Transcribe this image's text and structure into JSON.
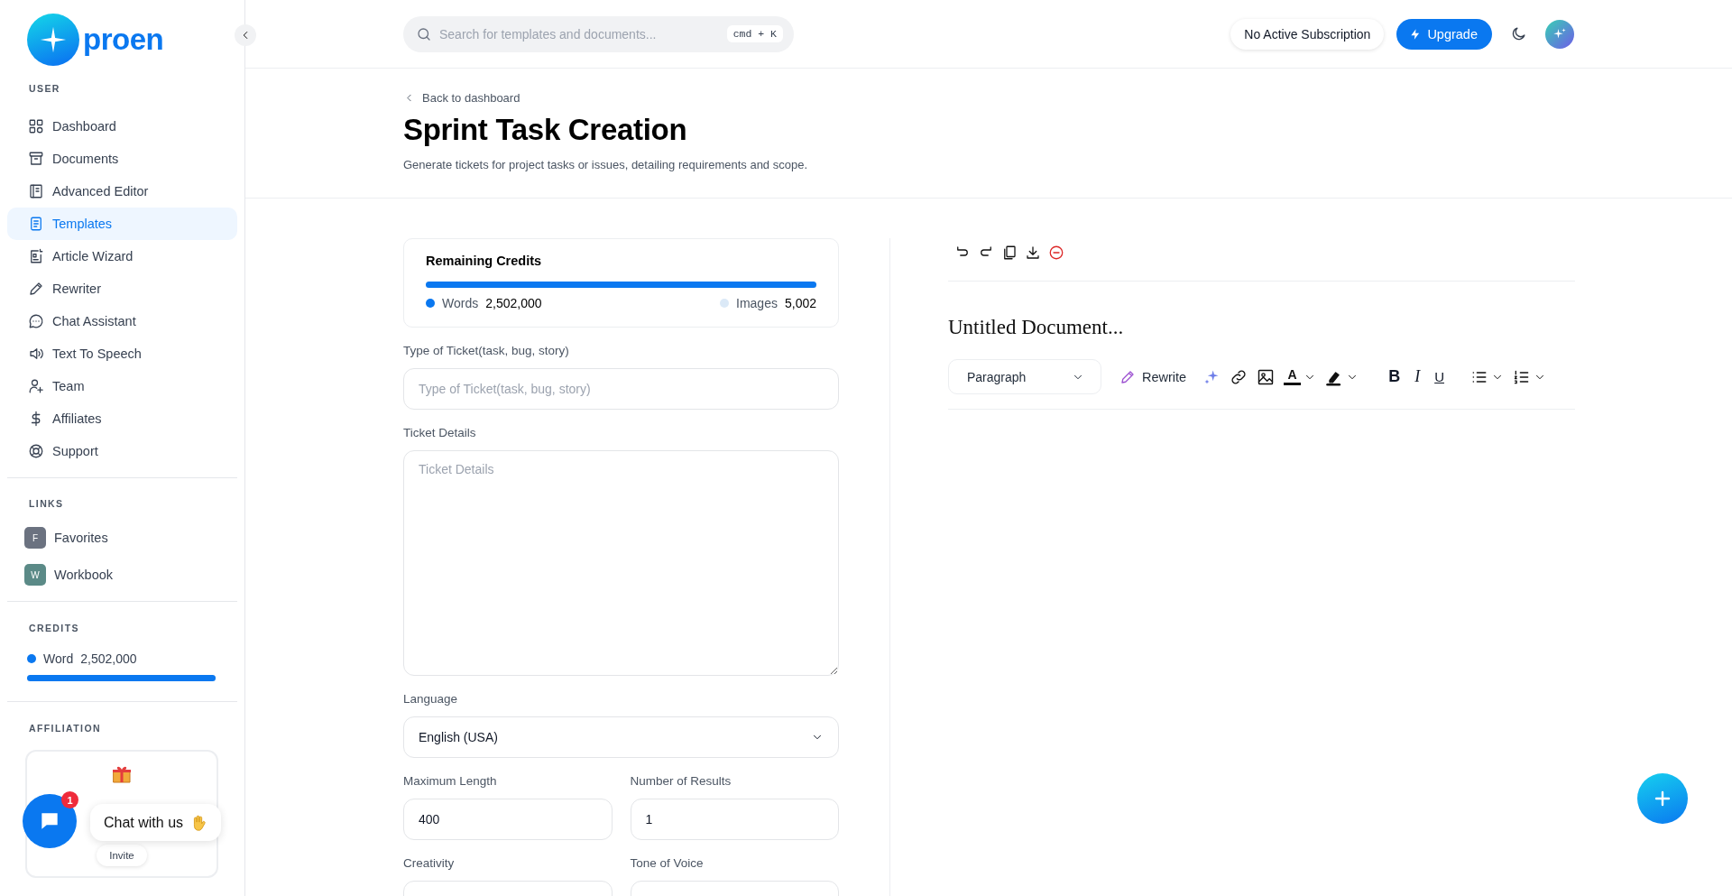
{
  "sidebar": {
    "brand": "proen",
    "nav": {
      "title": "USER",
      "items": [
        {
          "label": "Dashboard",
          "selected": false
        },
        {
          "label": "Documents",
          "selected": false
        },
        {
          "label": "Advanced Editor",
          "selected": false
        },
        {
          "label": "Templates",
          "selected": true
        },
        {
          "label": "Article Wizard",
          "selected": false
        },
        {
          "label": "Rewriter",
          "selected": false
        },
        {
          "label": "Chat Assistant",
          "selected": false
        },
        {
          "label": "Text To Speech",
          "selected": false
        },
        {
          "label": "Team",
          "selected": false
        },
        {
          "label": "Affiliates",
          "selected": false
        },
        {
          "label": "Support",
          "selected": false
        }
      ]
    },
    "links": {
      "title": "LINKS",
      "items": [
        {
          "letter": "F",
          "label": "Favorites",
          "color": "#6b7280"
        },
        {
          "letter": "W",
          "label": "Workbook",
          "color": "#5b8a87"
        }
      ]
    },
    "credits": {
      "title": "CREDITS",
      "label": "Word",
      "value": "2,502,000",
      "level": 1
    },
    "affiliation": {
      "title": "AFFILIATION",
      "button": "Invite"
    }
  },
  "chat": {
    "label": "Chat with us",
    "badge": "1"
  },
  "header": {
    "search_placeholder": "Search for templates and documents...",
    "shortcut": "cmd + K",
    "subscription": "No Active Subscription",
    "upgrade": "Upgrade",
    "dark_mode": false
  },
  "page": {
    "back": "Back to dashboard",
    "title": "Sprint Task Creation",
    "subtitle": "Generate tickets for project tasks or issues, detailing requirements and scope."
  },
  "credits_card": {
    "title": "Remaining Credits",
    "level": 1,
    "legend": [
      {
        "label": "Words",
        "value": "2,502,000",
        "color": "#0a78f0"
      },
      {
        "label": "Images",
        "value": "5,002",
        "color": "#dbe9f7"
      }
    ]
  },
  "form": {
    "rows": [
      {
        "fields": [
          {
            "kind": "text",
            "label": "Type of Ticket(task, bug, story)",
            "placeholder": "Type of Ticket(task, bug, story)"
          }
        ]
      },
      {
        "fields": [
          {
            "kind": "textarea",
            "label": "Ticket Details",
            "placeholder": "Ticket Details"
          }
        ]
      },
      {
        "fields": [
          {
            "kind": "select",
            "label": "Language",
            "value": "English (USA)"
          }
        ]
      },
      {
        "fields": [
          {
            "kind": "text",
            "label": "Maximum Length",
            "value": "400"
          },
          {
            "kind": "text",
            "label": "Number of Results",
            "value": "1"
          }
        ]
      },
      {
        "fields": [
          {
            "kind": "cut",
            "label": "Creativity"
          },
          {
            "kind": "cut",
            "label": "Tone of Voice"
          }
        ]
      }
    ]
  },
  "editor": {
    "document_title": "Untitled Document...",
    "block_style": "Paragraph",
    "rewrite": "Rewrite",
    "text_color_glyph": "A",
    "marks": [
      {
        "kind": "bold",
        "glyph": "B"
      },
      {
        "kind": "italic",
        "glyph": "I"
      },
      {
        "kind": "underline",
        "glyph": "U"
      }
    ]
  }
}
